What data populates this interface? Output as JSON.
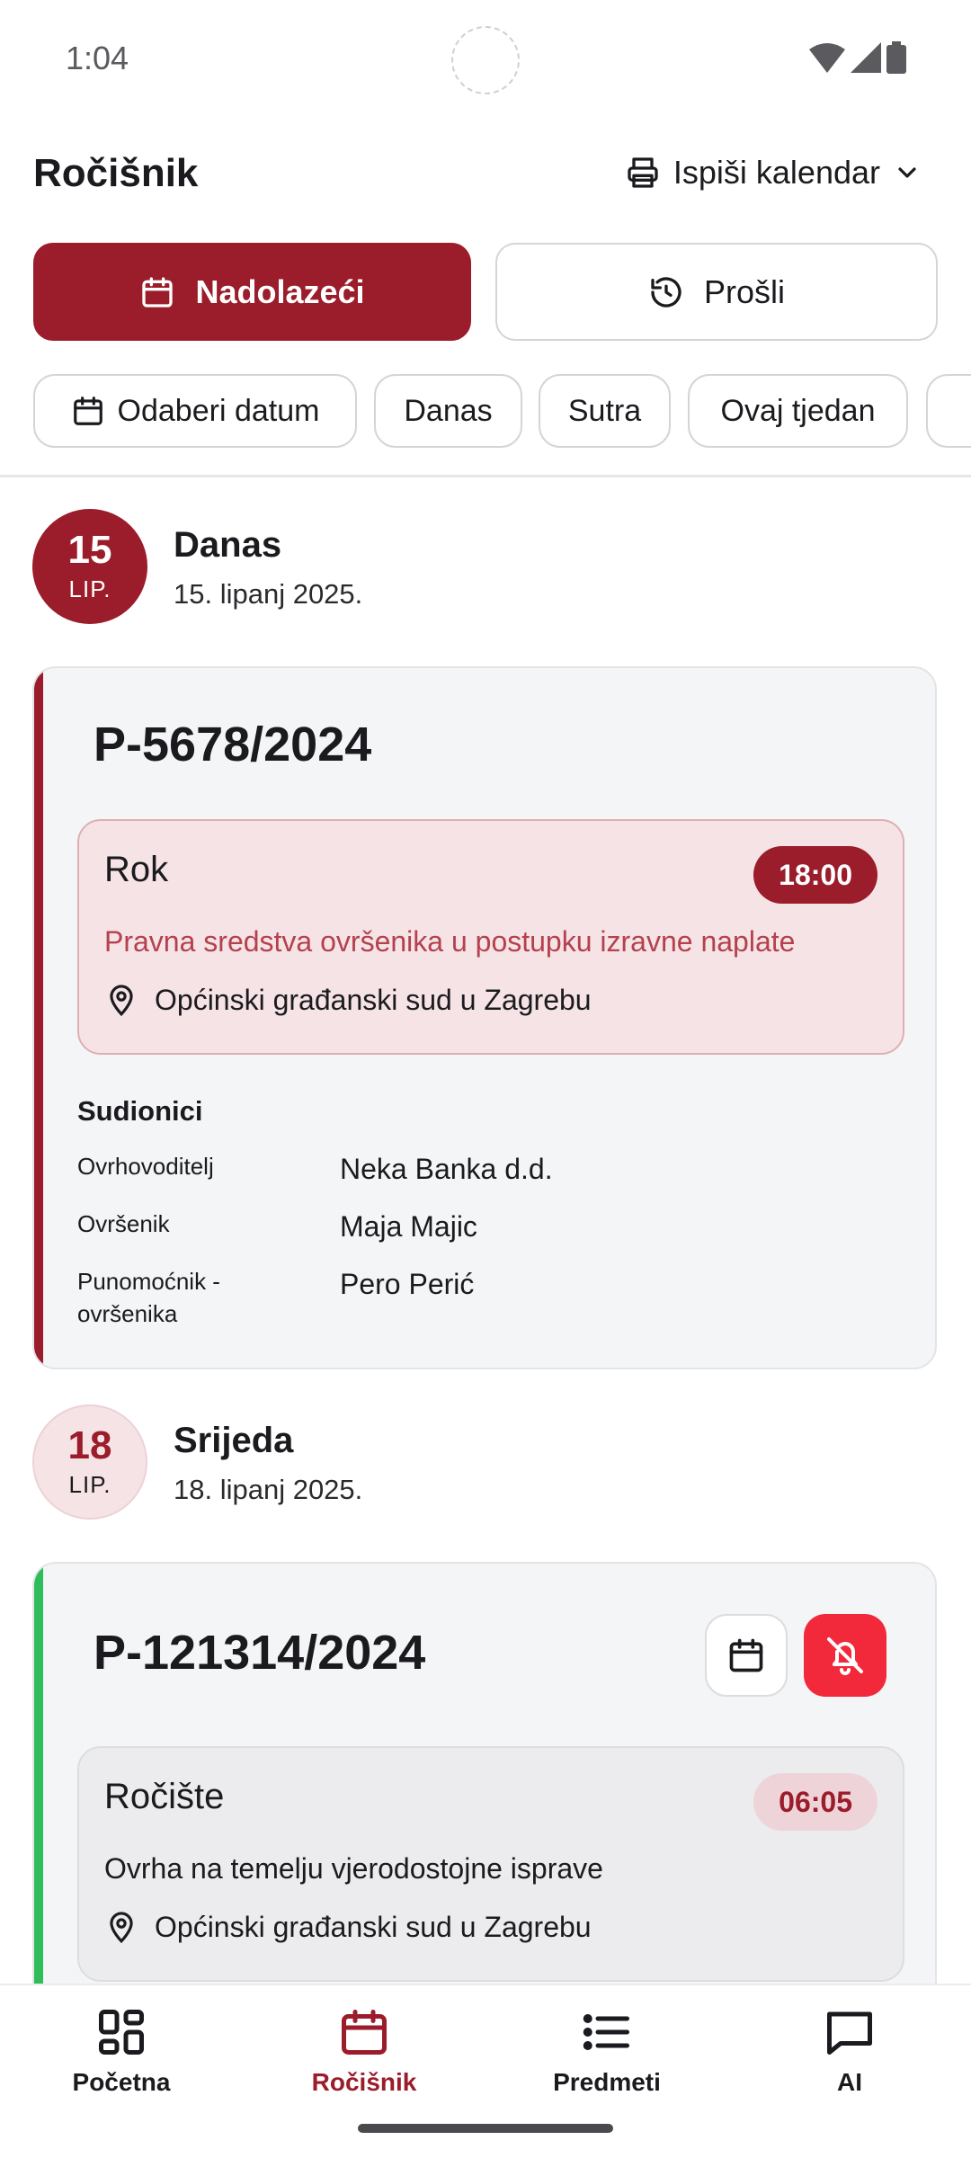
{
  "status_bar": {
    "time": "1:04"
  },
  "header": {
    "title": "Ročišnik",
    "print_label": "Ispiši kalendar"
  },
  "segments": {
    "upcoming": "Nadolazeći",
    "past": "Prošli"
  },
  "filters": [
    "Odaberi datum",
    "Danas",
    "Sutra",
    "Ovaj tjedan"
  ],
  "colors": {
    "accent": "#9b1c2a",
    "green": "#2ebd59",
    "alarm": "#f2293a"
  },
  "days": [
    {
      "day_num": "15",
      "month": "LIP.",
      "weekday": "Danas",
      "full_date": "15. lipanj 2025.",
      "case": {
        "number": "P-5678/2024",
        "event": {
          "type": "Rok",
          "time": "18:00",
          "description": "Pravna sredstva ovršenika u postupku izravne naplate",
          "location": "Općinski građanski sud u Zagrebu"
        },
        "participants_title": "Sudionici",
        "participants": [
          {
            "role": "Ovrhovoditelj",
            "name": "Neka Banka d.d."
          },
          {
            "role": "Ovršenik",
            "name": "Maja Majic"
          },
          {
            "role": "Punomoćnik - ovršenika",
            "name": "Pero Perić"
          }
        ]
      }
    },
    {
      "day_num": "18",
      "month": "LIP.",
      "weekday": "Srijeda",
      "full_date": "18. lipanj 2025.",
      "case": {
        "number": "P-121314/2024",
        "event": {
          "type": "Ročište",
          "time": "06:05",
          "description": "Ovrha na temelju vjerodostojne isprave",
          "location": "Općinski građanski sud u Zagrebu"
        }
      }
    }
  ],
  "nav": [
    {
      "label": "Početna",
      "icon": "grid-icon"
    },
    {
      "label": "Ročišnik",
      "icon": "calendar-icon"
    },
    {
      "label": "Predmeti",
      "icon": "list-icon"
    },
    {
      "label": "AI",
      "icon": "chat-icon"
    }
  ]
}
